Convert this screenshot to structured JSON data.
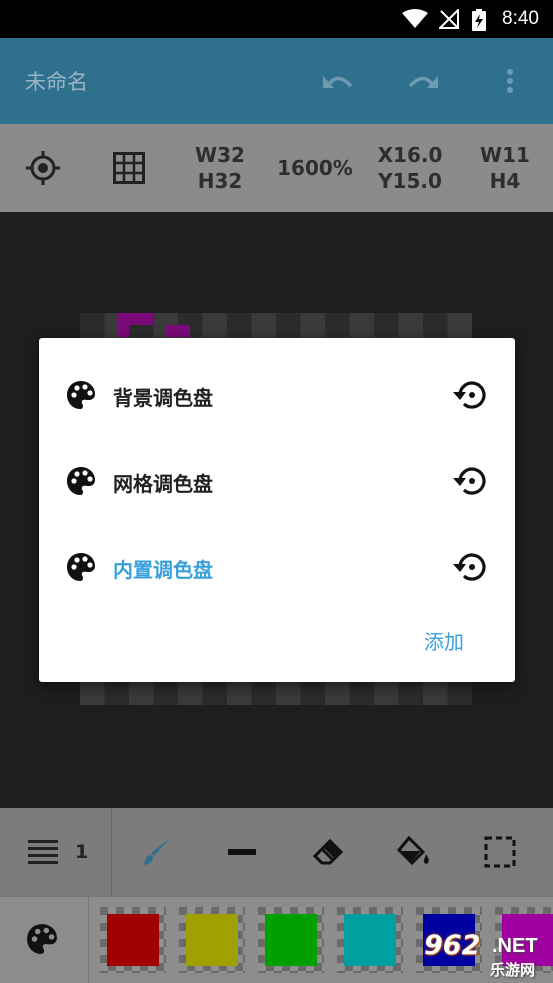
{
  "status": {
    "time": "8:40"
  },
  "appbar": {
    "title": "未命名",
    "colors": {
      "bar": "#2f708e",
      "title": "#99b6c5"
    }
  },
  "infobar": {
    "canvas_size": {
      "w": "W32",
      "h": "H32"
    },
    "zoom": "1600%",
    "cursor": {
      "x": "X16.0",
      "y": "Y15.0"
    },
    "selection": {
      "w": "W11",
      "h": "H4"
    }
  },
  "dialog": {
    "items": [
      {
        "label": "背景调色盘",
        "active": false
      },
      {
        "label": "网格调色盘",
        "active": false
      },
      {
        "label": "内置调色盘",
        "active": true
      }
    ],
    "add_label": "添加",
    "accent_color": "#3aa0dc"
  },
  "toolbar": {
    "layer_count": "1",
    "tools": [
      "brush-icon",
      "line-icon",
      "eraser-icon",
      "fill-bucket-icon",
      "select-rect-icon"
    ]
  },
  "palette": {
    "swatches": [
      "#a00000",
      "#a0a000",
      "#00a000",
      "#00a0a0",
      "#0000a0",
      "#a000a0"
    ]
  },
  "watermark": {
    "number": "962",
    "domain": ".NET",
    "sub": "乐游网"
  }
}
